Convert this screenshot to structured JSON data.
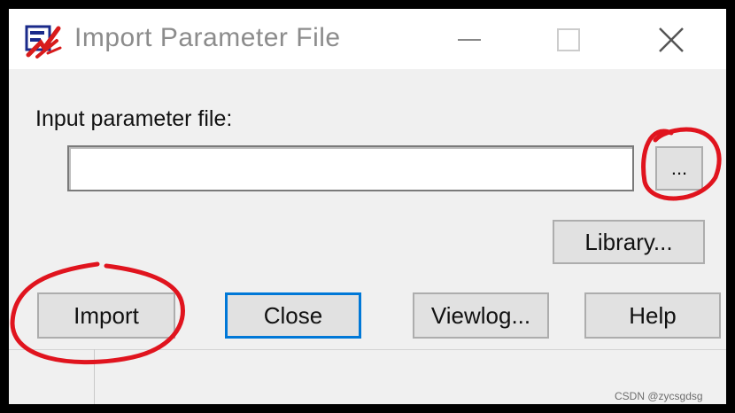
{
  "window": {
    "title": "Import Parameter File",
    "app_icon": "parameter-file-app-icon",
    "controls": {
      "minimize_icon": "minimize-icon",
      "maximize_icon": "maximize-icon",
      "close_icon": "close-icon"
    }
  },
  "form": {
    "input_label": "Input parameter file:",
    "input_value": "",
    "browse_label": "...",
    "library_label": "Library..."
  },
  "actions": {
    "import_label": "Import",
    "close_label": "Close",
    "viewlog_label": "Viewlog...",
    "help_label": "Help"
  },
  "watermark": "CSDN @zycsgdsg",
  "colors": {
    "dialog_bg": "#f0f0f0",
    "titlebar_bg": "#ffffff",
    "button_bg": "#e1e1e1",
    "focus_border": "#0078d7",
    "annotation_red": "#e0141e"
  }
}
